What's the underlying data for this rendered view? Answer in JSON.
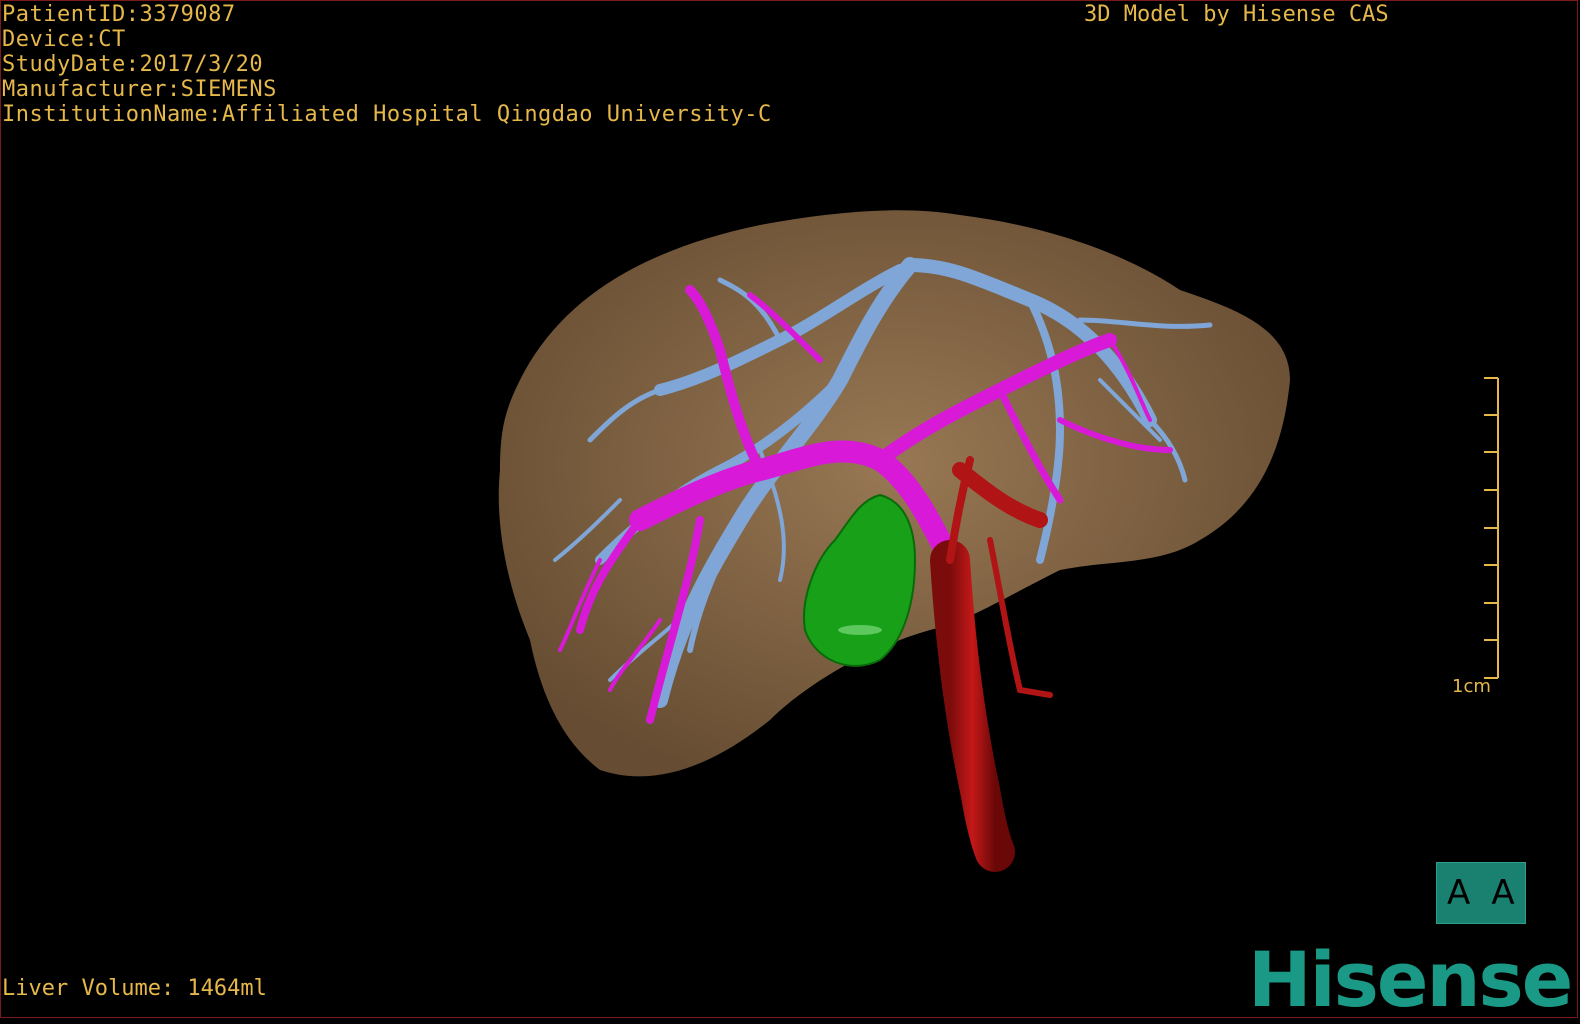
{
  "info": {
    "patient": "PatientID:3379087",
    "device": "Device:CT",
    "study_date": "StudyDate:2017/3/20",
    "manufacturer": "Manufacturer:SIEMENS",
    "institution": "InstitutionName:Affiliated Hospital Qingdao University-C"
  },
  "credit": "3D Model by Hisense CAS",
  "volume": "Liver Volume: 1464ml",
  "scale_label": "1cm",
  "view_button": {
    "left_glyph": "A",
    "right_glyph": "A"
  },
  "logo": "Hisense",
  "colors": {
    "text": "#e6b84a",
    "liver": "#8a6a48",
    "hepatic_vein": "#7fa6d6",
    "portal_vein": "#d81ad8",
    "ivc_aorta": "#b01414",
    "gallbladder": "#18a018",
    "brand": "#1a9a86"
  }
}
